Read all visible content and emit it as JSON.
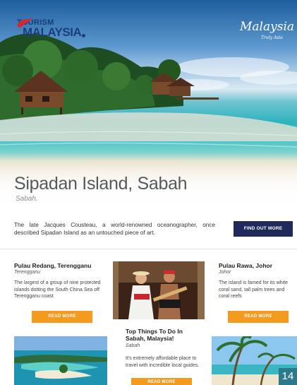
{
  "header": {
    "logo_left_line1": "TOURISM",
    "logo_left_line2": "MALAYSIA",
    "logo_right_line1": "Malaysia",
    "logo_right_line2": "Truly Asia"
  },
  "hero": {
    "title": "Sipadan Island, Sabah",
    "subtitle": "Sabah."
  },
  "intro": {
    "text": "The late Jacques Cousteau, a world-renowned oceanographer, once described Sipadan Island as an untouched piece of art.",
    "button": "FIND OUT MORE"
  },
  "cards": [
    {
      "title": "Pulau Redang, Terengganu",
      "subtitle": "Terengganu",
      "body": "The largest of a group of nine protected islands dotting the South China Sea off Terengganu coast",
      "button": "READ MORE"
    },
    {
      "title": "Pulau Rawa, Johor",
      "subtitle": "Johor",
      "body": "The island is famed for its white coral sand, tall palm trees and coral reefs",
      "button": "READ MORE"
    },
    {
      "title": "Top Things To Do In Sabah, Malaysia!",
      "subtitle": "Sabah",
      "body": "It's extremely affordable place to travel with incredible local guides.",
      "button": "READ MORE"
    }
  ],
  "page_number": "14",
  "colors": {
    "button_dark": "#1f2a5a",
    "button_orange": "#f39a1f",
    "page_badge": "#2a7a8c"
  }
}
